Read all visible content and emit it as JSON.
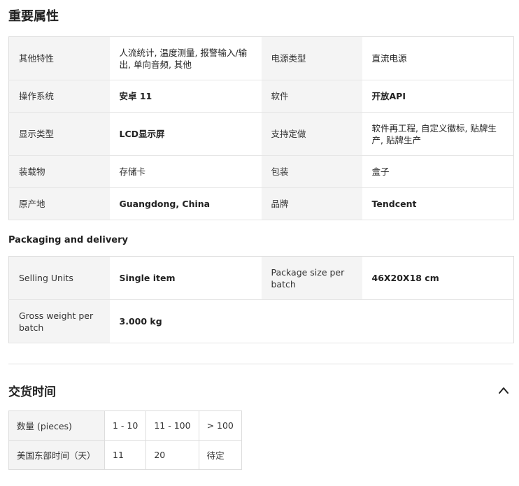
{
  "attributes": {
    "title": "重要属性",
    "rows": [
      [
        {
          "key": "其他特性",
          "value": "人流统计, 温度测量, 报警输入/输出, 单向音频, 其他"
        },
        {
          "key": "电源类型",
          "value": "直流电源"
        }
      ],
      [
        {
          "key": "操作系统",
          "value": "安卓 11"
        },
        {
          "key": "软件",
          "value": "开放API"
        }
      ],
      [
        {
          "key": "显示类型",
          "value": "LCD显示屏"
        },
        {
          "key": "支持定做",
          "value": "软件再工程, 自定义徽标, 贴牌生产, 贴牌生产"
        }
      ],
      [
        {
          "key": "装载物",
          "value": "存储卡"
        },
        {
          "key": "包装",
          "value": "盒子"
        }
      ],
      [
        {
          "key": "原产地",
          "value": "Guangdong, China"
        },
        {
          "key": "品牌",
          "value": "Tendcent"
        }
      ]
    ]
  },
  "packaging": {
    "title": "Packaging and delivery",
    "rows": [
      [
        {
          "key": "Selling Units",
          "value": "Single item"
        },
        {
          "key": "Package size per batch",
          "value": "46X20X18 cm"
        }
      ],
      [
        {
          "key": "Gross weight per batch",
          "value": "3.000 kg"
        }
      ]
    ]
  },
  "lead_time": {
    "title": "交货时间",
    "collapse_icon": "chevron-up-icon",
    "header": {
      "label": "数量 (pieces)",
      "cols": [
        "1 - 10",
        "11 - 100",
        "> 100"
      ]
    },
    "row": {
      "label": "美国东部时间（天）",
      "cols": [
        "11",
        "20",
        "待定"
      ]
    }
  }
}
